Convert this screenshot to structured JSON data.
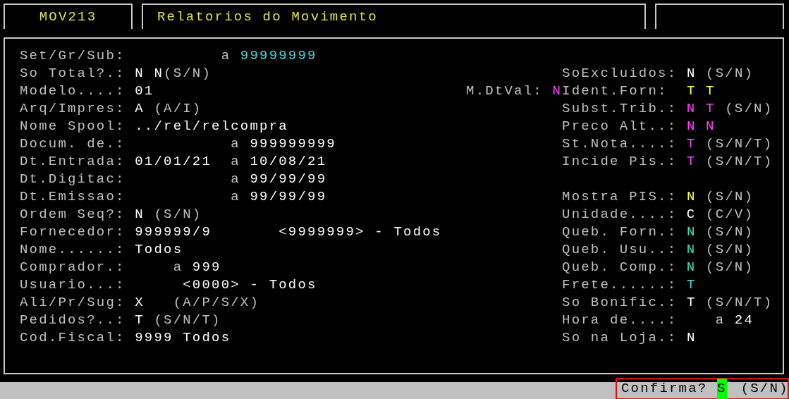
{
  "header": {
    "program_code": "MOV213",
    "title": "Relatorios do Movimento"
  },
  "form": {
    "rows": [
      {
        "left": [
          {
            "kind": "label",
            "text": "Set/Gr/Sub:"
          },
          {
            "kind": "value",
            "text": "a",
            "color": "#c0c0c0"
          },
          {
            "kind": "value",
            "text": "99999999",
            "color": "#40e0e0"
          }
        ]
      },
      {
        "left": [
          {
            "kind": "label",
            "text": "So Total?.:"
          },
          {
            "kind": "value",
            "text": "N",
            "color": "#ffffff"
          },
          {
            "kind": "value",
            "text": "N",
            "color": "#ffffff"
          },
          {
            "kind": "hint",
            "text": "(S/N)"
          }
        ],
        "right": [
          {
            "kind": "label",
            "text": "SoExcluidos:"
          },
          {
            "kind": "value",
            "text": "N",
            "color": "#ffffff"
          },
          {
            "kind": "hint",
            "text": "(S/N)"
          }
        ]
      },
      {
        "left": [
          {
            "kind": "label",
            "text": "Modelo....:"
          },
          {
            "kind": "value",
            "text": "01",
            "color": "#ffffff"
          }
        ],
        "right": [
          {
            "kind": "label",
            "text": "M.DtVal:"
          },
          {
            "kind": "value",
            "text": "N",
            "color": "#ff40ff"
          },
          {
            "kind": "label",
            "text": "Ident.Forn:"
          },
          {
            "kind": "value",
            "text": "T",
            "color": "#ffff40"
          },
          {
            "kind": "value",
            "text": "T",
            "color": "#ffff40"
          }
        ]
      },
      {
        "left": [
          {
            "kind": "label",
            "text": "Arq/Impres:"
          },
          {
            "kind": "value",
            "text": "A",
            "color": "#ffffff"
          },
          {
            "kind": "hint",
            "text": "(A/I)"
          }
        ],
        "right": [
          {
            "kind": "label",
            "text": "Subst.Trib.:"
          },
          {
            "kind": "value",
            "text": "N",
            "color": "#ff40ff"
          },
          {
            "kind": "value",
            "text": "T",
            "color": "#ff40ff"
          },
          {
            "kind": "hint",
            "text": "(S/N)"
          }
        ]
      },
      {
        "left": [
          {
            "kind": "label",
            "text": "Nome Spool:"
          },
          {
            "kind": "value",
            "text": "../rel/relcompra",
            "color": "#ffffff"
          }
        ],
        "right": [
          {
            "kind": "label",
            "text": "Preco Alt..:"
          },
          {
            "kind": "value",
            "text": "N",
            "color": "#ff40ff"
          },
          {
            "kind": "value",
            "text": "N",
            "color": "#ff40ff"
          }
        ]
      },
      {
        "left": [
          {
            "kind": "label",
            "text": "Docum. de.:"
          },
          {
            "kind": "value",
            "text": "a",
            "color": "#c0c0c0"
          },
          {
            "kind": "value",
            "text": "999999999",
            "color": "#ffffff"
          }
        ],
        "right": [
          {
            "kind": "label",
            "text": "St.Nota....:"
          },
          {
            "kind": "value",
            "text": "T",
            "color": "#ff40ff"
          },
          {
            "kind": "hint",
            "text": "(S/N/T)"
          }
        ]
      },
      {
        "left": [
          {
            "kind": "label",
            "text": "Dt.Entrada:"
          },
          {
            "kind": "value",
            "text": "01/01/21",
            "color": "#ffffff"
          },
          {
            "kind": "value",
            "text": "a",
            "color": "#c0c0c0"
          },
          {
            "kind": "value",
            "text": "10/08/21",
            "color": "#ffffff"
          }
        ],
        "right": [
          {
            "kind": "label",
            "text": "Incide Pis.:"
          },
          {
            "kind": "value",
            "text": "T",
            "color": "#ff40ff"
          },
          {
            "kind": "hint",
            "text": "(S/N/T)"
          }
        ]
      },
      {
        "left": [
          {
            "kind": "label",
            "text": "Dt.Digitac:"
          },
          {
            "kind": "value",
            "text": "a",
            "color": "#c0c0c0"
          },
          {
            "kind": "value",
            "text": "99/99/99",
            "color": "#ffffff"
          }
        ]
      },
      {
        "left": [
          {
            "kind": "label",
            "text": "Dt.Emissao:"
          },
          {
            "kind": "value",
            "text": "a",
            "color": "#c0c0c0"
          },
          {
            "kind": "value",
            "text": "99/99/99",
            "color": "#ffffff"
          }
        ],
        "right": [
          {
            "kind": "label",
            "text": "Mostra PIS.:"
          },
          {
            "kind": "value",
            "text": "N",
            "color": "#ffff40"
          },
          {
            "kind": "hint",
            "text": "(S/N)"
          }
        ]
      },
      {
        "left": [
          {
            "kind": "label",
            "text": "Ordem Seq?:"
          },
          {
            "kind": "value",
            "text": "N",
            "color": "#ffffff"
          },
          {
            "kind": "hint",
            "text": "(S/N)"
          }
        ],
        "right": [
          {
            "kind": "label",
            "text": "Unidade....:"
          },
          {
            "kind": "value",
            "text": "C",
            "color": "#ffffff"
          },
          {
            "kind": "hint",
            "text": "(C/V)"
          }
        ]
      },
      {
        "left": [
          {
            "kind": "label",
            "text": "Fornecedor:"
          },
          {
            "kind": "value",
            "text": "999999/9",
            "color": "#ffffff"
          },
          {
            "kind": "value",
            "text": "<9999999> - Todos",
            "color": "#ffffff"
          }
        ],
        "right": [
          {
            "kind": "label",
            "text": "Queb. Forn.:"
          },
          {
            "kind": "value",
            "text": "N",
            "color": "#40e0b0"
          },
          {
            "kind": "hint",
            "text": "(S/N)"
          }
        ]
      },
      {
        "left": [
          {
            "kind": "label",
            "text": "Nome......:"
          },
          {
            "kind": "value",
            "text": "Todos",
            "color": "#ffffff"
          }
        ],
        "right": [
          {
            "kind": "label",
            "text": "Queb. Usu..:"
          },
          {
            "kind": "value",
            "text": "N",
            "color": "#40e0b0"
          },
          {
            "kind": "hint",
            "text": "(S/N)"
          }
        ]
      },
      {
        "left": [
          {
            "kind": "label",
            "text": "Comprador.:"
          },
          {
            "kind": "value",
            "text": "a",
            "color": "#c0c0c0"
          },
          {
            "kind": "value",
            "text": "999",
            "color": "#ffffff"
          }
        ],
        "right": [
          {
            "kind": "label",
            "text": "Queb. Comp.:"
          },
          {
            "kind": "value",
            "text": "N",
            "color": "#40e0b0"
          },
          {
            "kind": "hint",
            "text": "(S/N)"
          }
        ]
      },
      {
        "left": [
          {
            "kind": "label",
            "text": "Usuario...:"
          },
          {
            "kind": "value",
            "text": "<0000> - Todos",
            "color": "#ffffff"
          }
        ],
        "right": [
          {
            "kind": "label",
            "text": "Frete......:"
          },
          {
            "kind": "value",
            "text": "T",
            "color": "#40e0e0"
          }
        ]
      },
      {
        "left": [
          {
            "kind": "label",
            "text": "Ali/Pr/Sug:"
          },
          {
            "kind": "value",
            "text": "X",
            "color": "#ffffff"
          },
          {
            "kind": "hint",
            "text": "(A/P/S/X)"
          }
        ],
        "right": [
          {
            "kind": "label",
            "text": "So Bonific.:"
          },
          {
            "kind": "value",
            "text": "T",
            "color": "#ffffff"
          },
          {
            "kind": "hint",
            "text": "(S/N/T)"
          }
        ]
      },
      {
        "left": [
          {
            "kind": "label",
            "text": "Pedidos?..:"
          },
          {
            "kind": "value",
            "text": "T",
            "color": "#ffffff"
          },
          {
            "kind": "hint",
            "text": "(S/N/T)"
          }
        ],
        "right": [
          {
            "kind": "label",
            "text": "Hora de....:"
          },
          {
            "kind": "value",
            "text": "a",
            "color": "#c0c0c0"
          },
          {
            "kind": "value",
            "text": "24",
            "color": "#ffffff"
          }
        ]
      },
      {
        "left": [
          {
            "kind": "label",
            "text": "Cod.Fiscal:"
          },
          {
            "kind": "value",
            "text": "9999 Todos",
            "color": "#ffffff"
          }
        ],
        "right": [
          {
            "kind": "label",
            "text": "So na Loja.:"
          },
          {
            "kind": "value",
            "text": "N",
            "color": "#ffffff"
          }
        ]
      }
    ]
  },
  "status_bar": {
    "prompt": "Confirma?",
    "answer": "S",
    "hint": "(S/N)",
    "highlighted": true
  }
}
